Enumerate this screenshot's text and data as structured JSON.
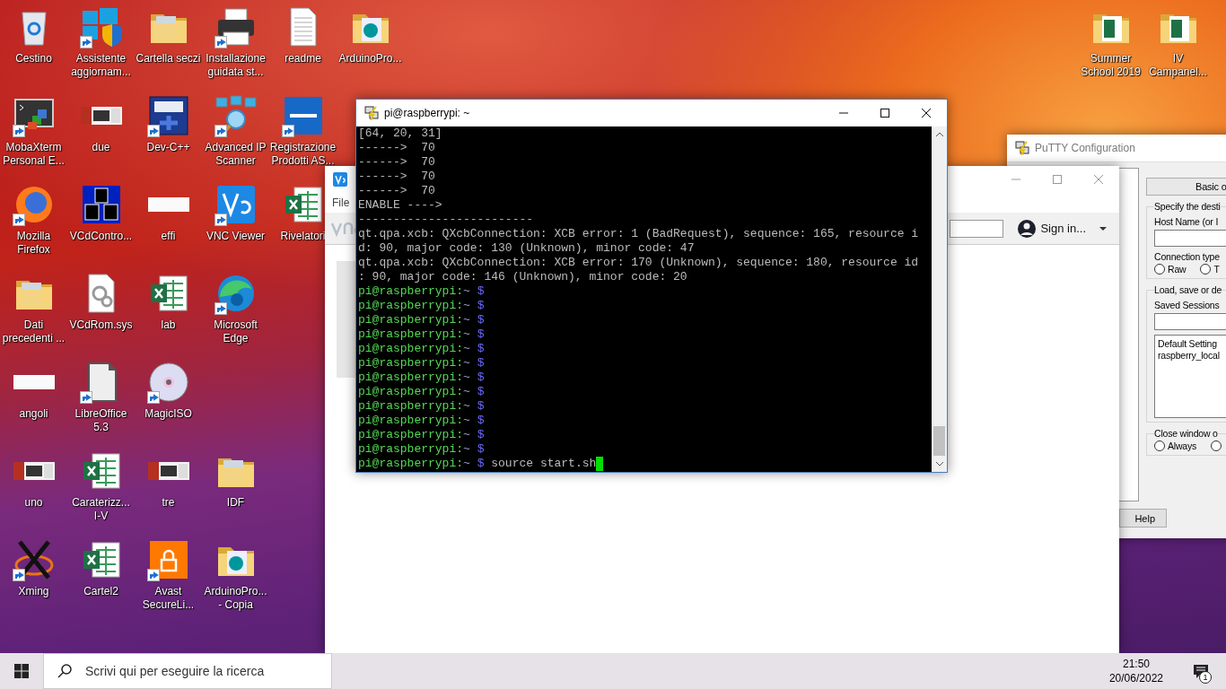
{
  "desktop": {
    "icon_rows": [
      [
        {
          "label": "Cestino",
          "kind": "recycle-bin",
          "shortcut": false
        },
        {
          "label": "Assistente aggiornam...",
          "kind": "windows-shield",
          "shortcut": true
        },
        {
          "label": "Cartella seczi",
          "kind": "folder",
          "shortcut": false
        },
        {
          "label": "Installazione guidata st...",
          "kind": "printer",
          "shortcut": true
        },
        {
          "label": "readme",
          "kind": "document",
          "shortcut": false
        },
        {
          "label": "ArduinoPro...",
          "kind": "arduino-folder",
          "shortcut": false
        }
      ],
      [
        {
          "label": "MobaXterm Personal E...",
          "kind": "terminal",
          "shortcut": true
        },
        {
          "label": "due",
          "kind": "thumbnail",
          "shortcut": false
        },
        {
          "label": "Dev-C++",
          "kind": "dev",
          "shortcut": true
        },
        {
          "label": "Advanced IP Scanner",
          "kind": "network",
          "shortcut": true
        },
        {
          "label": "Registrazione Prodotti AS...",
          "kind": "logo-tile",
          "shortcut": true
        }
      ],
      [
        {
          "label": "Mozilla Firefox",
          "kind": "globe",
          "shortcut": true
        },
        {
          "label": "VCdContro...",
          "kind": "blocks",
          "shortcut": false
        },
        {
          "label": "effi",
          "kind": "blank-thumbnail",
          "shortcut": false
        },
        {
          "label": "VNC Viewer",
          "kind": "app-tile",
          "shortcut": true
        },
        {
          "label": "Rivelatori",
          "kind": "spreadsheet",
          "shortcut": false
        }
      ],
      [
        {
          "label": "Dati precedenti ...",
          "kind": "folder",
          "shortcut": false
        },
        {
          "label": "VCdRom.sys",
          "kind": "gear-document",
          "shortcut": false
        },
        {
          "label": "lab",
          "kind": "spreadsheet",
          "shortcut": false
        },
        {
          "label": "Microsoft Edge",
          "kind": "swirl",
          "shortcut": true
        }
      ],
      [
        {
          "label": "angoli",
          "kind": "blank-thumbnail",
          "shortcut": false
        },
        {
          "label": "LibreOffice 5.3",
          "kind": "gray-document",
          "shortcut": true
        },
        {
          "label": "MagicISO",
          "kind": "disc",
          "shortcut": true
        }
      ],
      [
        {
          "label": "uno",
          "kind": "thumbnail",
          "shortcut": false
        },
        {
          "label": "Caraterizz... I-V",
          "kind": "spreadsheet",
          "shortcut": false
        },
        {
          "label": "tre",
          "kind": "thumbnail",
          "shortcut": false
        },
        {
          "label": "IDF",
          "kind": "folder",
          "shortcut": false
        }
      ],
      [
        {
          "label": "Xming",
          "kind": "cross-ring",
          "shortcut": true
        },
        {
          "label": "Cartel2",
          "kind": "spreadsheet",
          "shortcut": false
        },
        {
          "label": "Avast SecureLi...",
          "kind": "padlock-tile",
          "shortcut": true
        },
        {
          "label": "ArduinoPro... - Copia",
          "kind": "arduino-folder",
          "shortcut": false
        }
      ]
    ],
    "right_icons": [
      {
        "label": "Summer School 2019",
        "kind": "spreadsheet-folder",
        "shortcut": false
      },
      {
        "label": "IV Campanel...",
        "kind": "spreadsheet-folder",
        "shortcut": false
      }
    ]
  },
  "putty_config": {
    "title": "PuTTY Configuration",
    "header": "Basic o",
    "groups": [
      {
        "legend": "Specify the desti",
        "items": [
          {
            "kind": "label",
            "text": "Host Name (or I"
          },
          {
            "kind": "field"
          },
          {
            "kind": "label",
            "text": "Connection type"
          },
          {
            "kind": "radios",
            "options": [
              {
                "label": "Raw",
                "selected": false
              },
              {
                "label": "T",
                "selected": false
              }
            ]
          }
        ]
      },
      {
        "legend": "Load, save or de",
        "items": [
          {
            "kind": "label",
            "text": "Saved Sessions"
          },
          {
            "kind": "field"
          },
          {
            "kind": "list",
            "entries": [
              "Default Setting",
              "raspberry_local"
            ]
          }
        ]
      },
      {
        "legend": "Close window o",
        "items": [
          {
            "kind": "radios",
            "options": [
              {
                "label": "Always",
                "selected": false
              },
              {
                "selected": false
              }
            ]
          }
        ]
      }
    ],
    "help_button": "Help"
  },
  "vnc_viewer": {
    "menu": [
      "File"
    ],
    "account": "Sign in..."
  },
  "terminal": {
    "title": "pi@raspberrypi: ~",
    "lines": [
      {
        "kind": "output",
        "text": "[64, 20, 31]"
      },
      {
        "kind": "output",
        "text": "------>  70"
      },
      {
        "kind": "output",
        "text": "------>  70"
      },
      {
        "kind": "output",
        "text": "------>  70"
      },
      {
        "kind": "output",
        "text": "------>  70"
      },
      {
        "kind": "output",
        "text": "ENABLE ---->"
      },
      {
        "kind": "output",
        "text": "-------------------------"
      },
      {
        "kind": "output",
        "text": "qt.qpa.xcb: QXcbConnection: XCB error: 1 (BadRequest), sequence: 165, resource i"
      },
      {
        "kind": "output",
        "text": "d: 90, major code: 130 (Unknown), minor code: 47"
      },
      {
        "kind": "output",
        "text": "qt.qpa.xcb: QXcbConnection: XCB error: 170 (Unknown), sequence: 180, resource id"
      },
      {
        "kind": "output",
        "text": ": 90, major code: 146 (Unknown), minor code: 20"
      },
      {
        "kind": "prompt",
        "user": "pi@raspberrypi:",
        "path": "~",
        "symbol": "$",
        "cursor": false
      },
      {
        "kind": "prompt",
        "user": "pi@raspberrypi:",
        "path": "~",
        "symbol": "$",
        "cursor": false
      },
      {
        "kind": "prompt",
        "user": "pi@raspberrypi:",
        "path": "~",
        "symbol": "$",
        "cursor": false
      },
      {
        "kind": "prompt",
        "user": "pi@raspberrypi:",
        "path": "~",
        "symbol": "$",
        "cursor": false
      },
      {
        "kind": "prompt",
        "user": "pi@raspberrypi:",
        "path": "~",
        "symbol": "$",
        "cursor": false
      },
      {
        "kind": "prompt",
        "user": "pi@raspberrypi:",
        "path": "~",
        "symbol": "$",
        "cursor": false
      },
      {
        "kind": "prompt",
        "user": "pi@raspberrypi:",
        "path": "~",
        "symbol": "$",
        "cursor": false
      },
      {
        "kind": "prompt",
        "user": "pi@raspberrypi:",
        "path": "~",
        "symbol": "$",
        "cursor": false
      },
      {
        "kind": "prompt",
        "user": "pi@raspberrypi:",
        "path": "~",
        "symbol": "$",
        "cursor": false
      },
      {
        "kind": "prompt",
        "user": "pi@raspberrypi:",
        "path": "~",
        "symbol": "$",
        "cursor": false
      },
      {
        "kind": "prompt",
        "user": "pi@raspberrypi:",
        "path": "~",
        "symbol": "$",
        "cursor": false
      },
      {
        "kind": "prompt",
        "user": "pi@raspberrypi:",
        "path": "~",
        "symbol": "$",
        "cursor": false
      },
      {
        "kind": "prompt",
        "user": "pi@raspberrypi:",
        "path": "~",
        "symbol": "$",
        "command": "source start.sh",
        "cursor": true
      }
    ]
  },
  "taskbar": {
    "search": {
      "placeholder": "Scrivi qui per eseguire la ricerca"
    },
    "time": "21:50",
    "date": "20/06/2022",
    "notifications": "1"
  }
}
